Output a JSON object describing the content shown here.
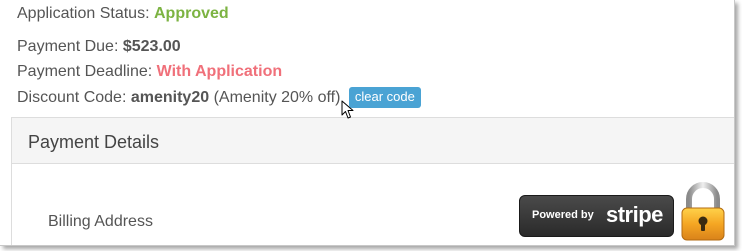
{
  "status": {
    "label": "Application Status:",
    "value": "Approved",
    "value_color": "#7cb342"
  },
  "payment_due": {
    "label": "Payment Due:",
    "value": "$523.00"
  },
  "payment_deadline": {
    "label": "Payment Deadline:",
    "value": "With Application",
    "value_color": "#f0707a"
  },
  "discount": {
    "label": "Discount Code:",
    "code": "amenity20",
    "description": "(Amenity 20% off)",
    "clear_label": "clear code",
    "clear_color": "#4aa3d4"
  },
  "panel": {
    "title": "Payment Details",
    "billing_label": "Billing Address"
  },
  "stripe": {
    "powered_by": "Powered by",
    "brand": "stripe",
    "badge_icon": "stripe-badge",
    "lock_icon": "padlock-icon"
  },
  "cursor_icon": "mouse-pointer-icon"
}
